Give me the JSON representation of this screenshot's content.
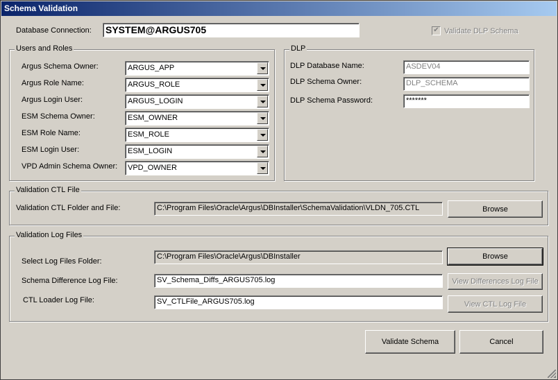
{
  "window": {
    "title": "Schema Validation"
  },
  "connection": {
    "label": "Database Connection:",
    "value": "SYSTEM@ARGUS705",
    "validate_dlp_label": "Validate DLP Schema",
    "validate_dlp_checked": true
  },
  "users_roles": {
    "title": "Users and Roles",
    "rows": [
      {
        "label": "Argus Schema Owner:",
        "value": "ARGUS_APP"
      },
      {
        "label": "Argus Role Name:",
        "value": "ARGUS_ROLE"
      },
      {
        "label": "Argus Login User:",
        "value": "ARGUS_LOGIN"
      },
      {
        "label": "ESM Schema Owner:",
        "value": "ESM_OWNER"
      },
      {
        "label": "ESM Role Name:",
        "value": "ESM_ROLE"
      },
      {
        "label": "ESM Login User:",
        "value": "ESM_LOGIN"
      },
      {
        "label": "VPD Admin Schema Owner:",
        "value": "VPD_OWNER"
      }
    ]
  },
  "dlp": {
    "title": "DLP",
    "db_name_label": "DLP Database Name:",
    "db_name_value": "ASDEV04",
    "owner_label": "DLP Schema Owner:",
    "owner_value": "DLP_SCHEMA",
    "password_label": "DLP Schema Password:",
    "password_value": "*******"
  },
  "ctl": {
    "title": "Validation CTL File",
    "label": "Validation CTL Folder and File:",
    "value": "C:\\Program Files\\Oracle\\Argus\\DBInstaller\\SchemaValidation\\VLDN_705.CTL",
    "browse_label": "Browse"
  },
  "logs": {
    "title": "Validation Log Files",
    "folder_label": "Select Log Files Folder:",
    "folder_value": "C:\\Program Files\\Oracle\\Argus\\DBInstaller",
    "browse_label": "Browse",
    "diff_label": "Schema Difference Log File:",
    "diff_value": "SV_Schema_Diffs_ARGUS705.log",
    "view_diff_label": "View Differences Log File",
    "ctl_log_label": "CTL Loader Log File:",
    "ctl_log_value": "SV_CTLFile_ARGUS705.log",
    "view_ctl_label": "View CTL Log File"
  },
  "actions": {
    "validate_label": "Validate Schema",
    "cancel_label": "Cancel"
  }
}
